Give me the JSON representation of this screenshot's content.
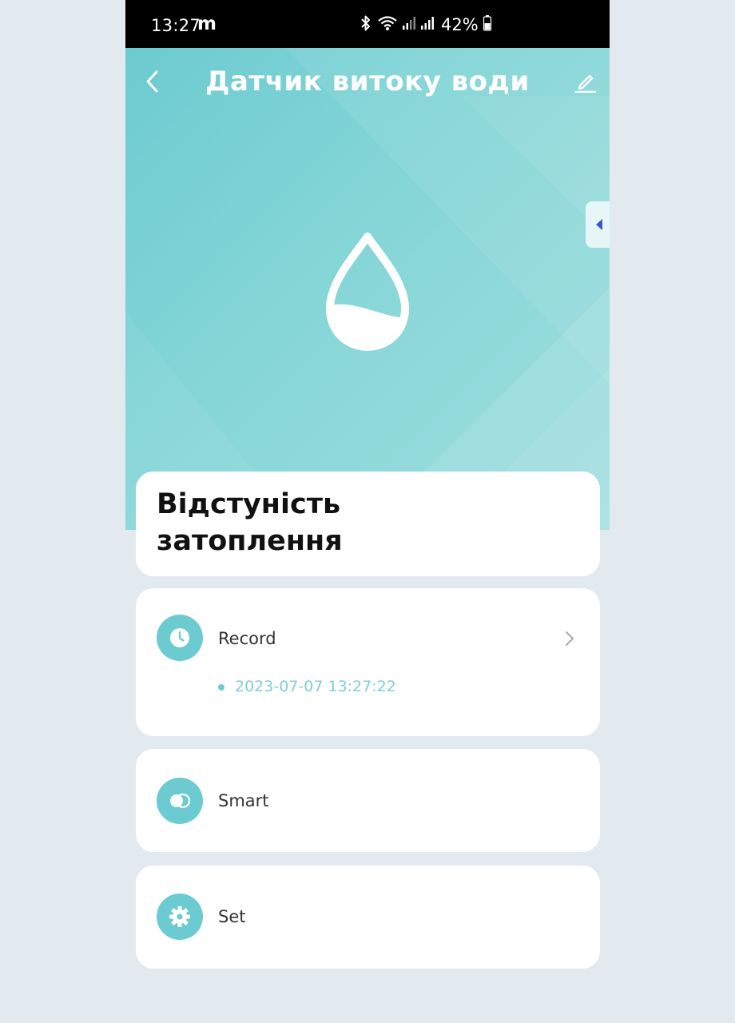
{
  "status_bar": {
    "time": "13:27",
    "notification_letter": "m",
    "battery": "42%",
    "icons": [
      "bluetooth-icon",
      "wifi-icon",
      "signal-icon",
      "signal-icon",
      "battery-icon"
    ]
  },
  "header": {
    "title": "Датчик витоку води",
    "back_icon": "chevron-left-icon",
    "edit_icon": "pencil-icon"
  },
  "hero": {
    "device_icon": "water-drop-icon",
    "side_tab_icon": "caret-left-icon",
    "colors": {
      "gradient_start": "#6ccbd0",
      "gradient_end": "#9fdedf"
    }
  },
  "status": {
    "line1": "Відстуність",
    "line2": "затоплення"
  },
  "menu": {
    "record": {
      "label": "Record",
      "icon": "clock-icon",
      "last_event": "2023-07-07 13:27:22"
    },
    "smart": {
      "label": "Smart",
      "icon": "toggle-icon"
    },
    "set": {
      "label": "Set",
      "icon": "gear-icon"
    }
  },
  "colors": {
    "accent": "#6ccbd0",
    "background": "#e2e9ef",
    "card": "#ffffff"
  }
}
